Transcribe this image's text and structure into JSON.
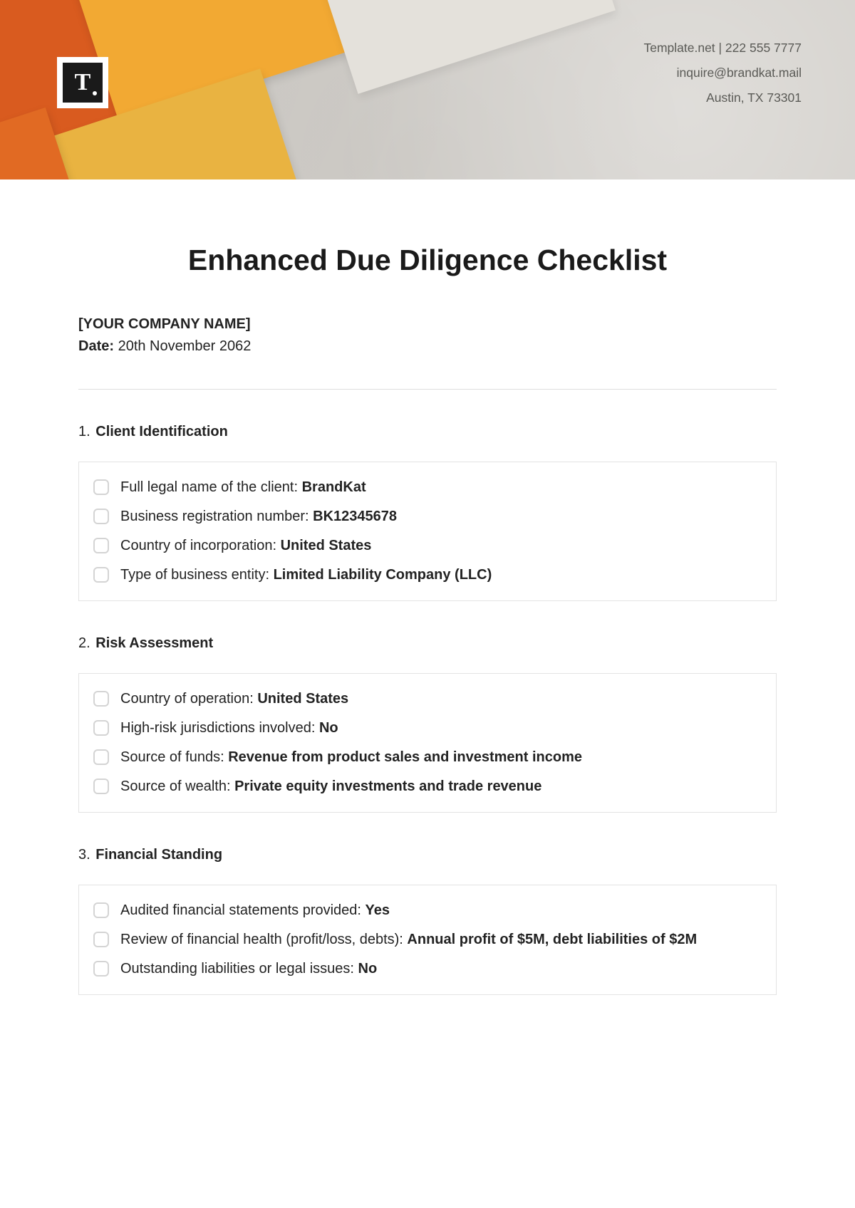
{
  "header": {
    "contact_line1": "Template.net  |  222 555 7777",
    "contact_line2": "inquire@brandkat.mail",
    "contact_line3": "Austin, TX 73301",
    "logo_letter": "T"
  },
  "document": {
    "title": "Enhanced Due Diligence Checklist",
    "company_name": "[YOUR COMPANY NAME]",
    "date_label": "Date:",
    "date_value": "20th November 2062"
  },
  "sections": [
    {
      "number": "1.",
      "name": "Client Identification",
      "items": [
        {
          "label": "Full legal name of the client: ",
          "value": "BrandKat"
        },
        {
          "label": "Business registration number: ",
          "value": "BK12345678"
        },
        {
          "label": "Country of incorporation: ",
          "value": "United States"
        },
        {
          "label": "Type of business entity: ",
          "value": "Limited Liability Company (LLC)"
        }
      ]
    },
    {
      "number": "2.",
      "name": "Risk Assessment",
      "items": [
        {
          "label": "Country of operation: ",
          "value": "United States"
        },
        {
          "label": "High-risk jurisdictions involved: ",
          "value": "No"
        },
        {
          "label": "Source of funds: ",
          "value": "Revenue from product sales and investment income"
        },
        {
          "label": "Source of wealth: ",
          "value": "Private equity investments and trade revenue"
        }
      ]
    },
    {
      "number": "3.",
      "name": "Financial Standing",
      "items": [
        {
          "label": "Audited financial statements provided: ",
          "value": "Yes"
        },
        {
          "label": "Review of financial health (profit/loss, debts): ",
          "value": "Annual profit of $5M, debt liabilities of $2M"
        },
        {
          "label": "Outstanding liabilities or legal issues: ",
          "value": "No"
        }
      ]
    }
  ]
}
